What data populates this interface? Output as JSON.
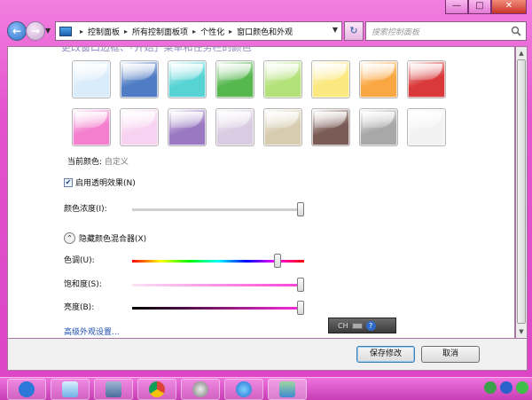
{
  "window": {
    "minimize_glyph": "—",
    "maximize_glyph": "□",
    "close_glyph": "✕"
  },
  "nav": {
    "back_glyph": "←",
    "forward_glyph": "→",
    "breadcrumb": [
      "控制面板",
      "所有控制面板项",
      "个性化",
      "窗口颜色和外观"
    ],
    "search_placeholder": "搜索控制面板",
    "refresh_glyph": "↻"
  },
  "content": {
    "cut_heading": "更改窗口边框、「开始」菜单和任务栏的颜色",
    "swatches_row1": [
      "#d9ecfb",
      "#4f7cc4",
      "#58d3d4",
      "#56b74f",
      "#b4e27a",
      "#fbe87e",
      "#f9a742",
      "#d9393a"
    ],
    "swatches_row2": [
      "#f37fcd",
      "#f8d3f1",
      "#9a79c2",
      "#d9cbe1",
      "#d7ccb0",
      "#7b5b55",
      "#a8a8a8",
      "#f2f2f2"
    ],
    "current_color_label": "当前颜色:",
    "current_color_value": "自定义",
    "transparency_label": "启用透明效果(N)",
    "transparency_checked": true,
    "intensity_label": "颜色浓度(I):",
    "intensity_level": 1.0,
    "mixer_toggle_label": "隐藏颜色混合器(X)",
    "hue_label": "色调(U):",
    "hue_level": 0.86,
    "saturation_label": "饱和度(S):",
    "saturation_level": 1.0,
    "brightness_label": "亮度(B):",
    "brightness_level": 1.0,
    "advanced_link": "高级外观设置...",
    "ime_text": "CH"
  },
  "buttons": {
    "save": "保存修改",
    "cancel": "取消"
  },
  "taskbar": {
    "apps": [
      "baidu-icon",
      "window-icon",
      "virtualbox-icon",
      "chrome-icon",
      "app-icon",
      "ie-icon",
      "control-panel-icon"
    ]
  }
}
